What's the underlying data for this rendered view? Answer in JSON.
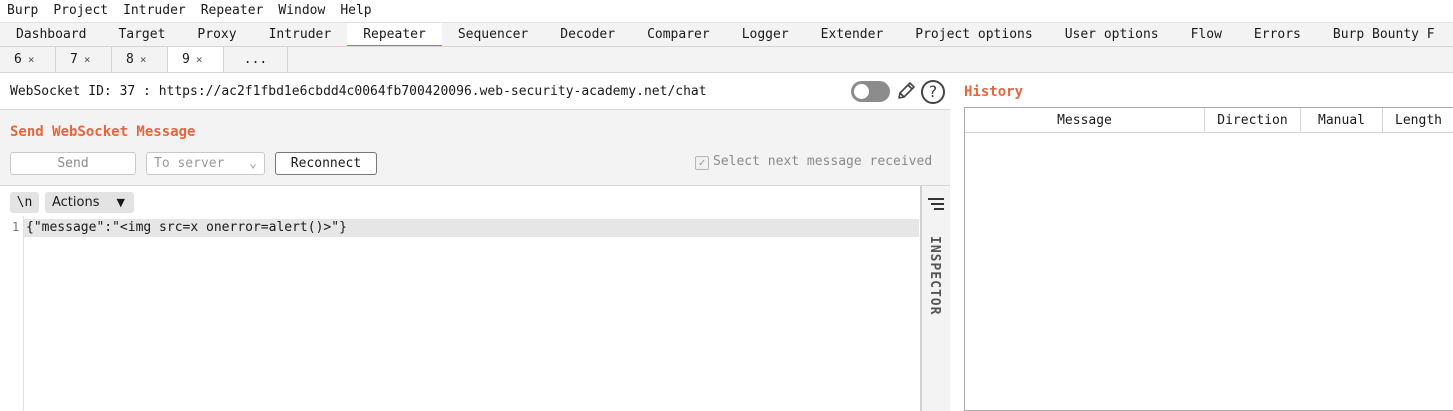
{
  "menu": [
    "Burp",
    "Project",
    "Intruder",
    "Repeater",
    "Window",
    "Help"
  ],
  "tool_tabs": [
    "Dashboard",
    "Target",
    "Proxy",
    "Intruder",
    "Repeater",
    "Sequencer",
    "Decoder",
    "Comparer",
    "Logger",
    "Extender",
    "Project options",
    "User options",
    "Flow",
    "Errors",
    "Burp Bounty F"
  ],
  "active_tool_tab": "Repeater",
  "repeater_tabs": [
    {
      "label": "6",
      "close": "×"
    },
    {
      "label": "7",
      "close": "×"
    },
    {
      "label": "8",
      "close": "×"
    },
    {
      "label": "9",
      "close": "×"
    }
  ],
  "repeater_more": "...",
  "ws_url_label": "WebSocket ID: 37 : https://ac2f1fbd1e6cbdd4c0064fb700420096.web-security-academy.net/chat",
  "send_panel": {
    "title": "Send WebSocket Message",
    "send_label": "Send",
    "direction_value": "To server",
    "reconnect_label": "Reconnect",
    "select_next_label": "Select next message received",
    "select_next_checked": true
  },
  "editor": {
    "newline_label": "\\n",
    "actions_label": "Actions",
    "line_number": "1",
    "content": "{\"message\":\"<img src=x onerror=alert()>\"}"
  },
  "inspector_label": "INSPECTOR",
  "history": {
    "title": "History",
    "columns": [
      "Message",
      "Direction",
      "Manual",
      "Length"
    ]
  },
  "colors": {
    "accent": "#e8643b",
    "panel_bg": "#f3f3f3"
  },
  "icons": [
    "pencil-icon",
    "help-icon",
    "toggle-switch",
    "inspector-menu-icon",
    "chevron-down-icon"
  ]
}
